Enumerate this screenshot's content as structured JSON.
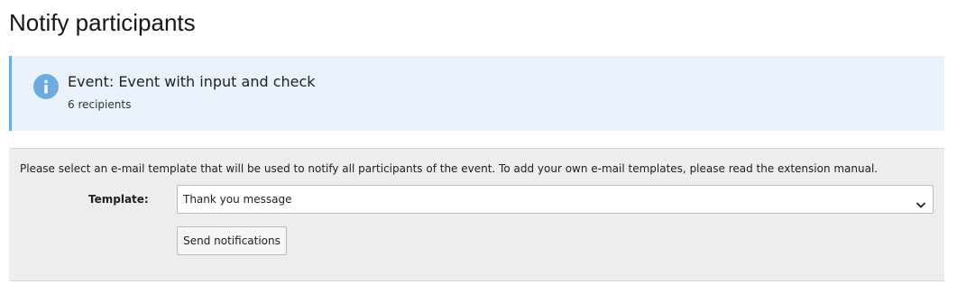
{
  "page": {
    "title": "Notify participants"
  },
  "info": {
    "icon": "info-icon",
    "title": "Event: Event with input and check",
    "recipients": "6 recipients",
    "accent_color": "#6daae0",
    "background_color": "#e9f2fb"
  },
  "form": {
    "description": "Please select an e-mail template that will be used to notify all participants of the event. To add your own e-mail templates, please read the extension manual.",
    "template_label": "Template:",
    "template_selected": "Thank you message",
    "select_icon": "chevron-down-icon",
    "send_button_label": "Send notifications",
    "background_color": "#ededed"
  }
}
